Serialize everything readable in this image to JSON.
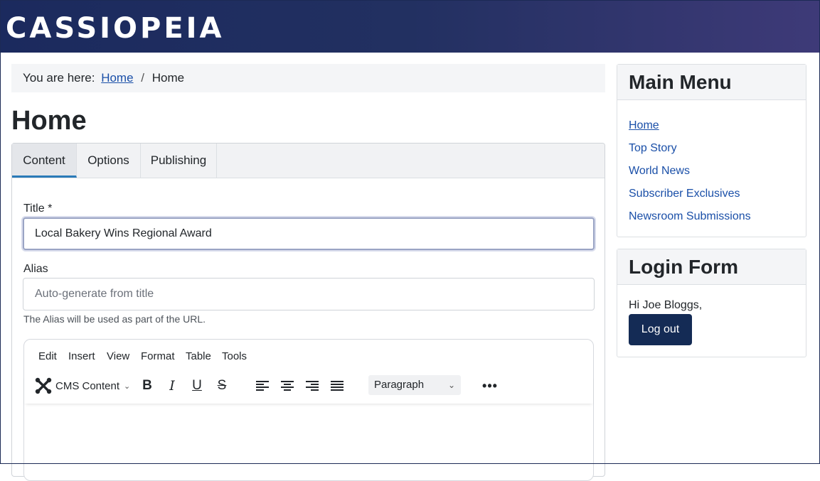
{
  "site": {
    "brand": "CASSIOPEIA"
  },
  "breadcrumb": {
    "prefix": "You are here:",
    "link": "Home",
    "separator": "/",
    "current": "Home"
  },
  "page_title": "Home",
  "tabs": [
    {
      "label": "Content",
      "active": true
    },
    {
      "label": "Options",
      "active": false
    },
    {
      "label": "Publishing",
      "active": false
    }
  ],
  "form": {
    "title_label": "Title *",
    "title_value": "Local Bakery Wins Regional Award",
    "alias_label": "Alias",
    "alias_placeholder": "Auto-generate from title",
    "alias_help": "The Alias will be used as part of the URL."
  },
  "editor": {
    "menus": [
      "Edit",
      "Insert",
      "View",
      "Format",
      "Table",
      "Tools"
    ],
    "cms_content_label": "CMS Content",
    "format_select": "Paragraph",
    "toolbar_icons": [
      "joomla-icon",
      "bold-icon",
      "italic-icon",
      "underline-icon",
      "strikethrough-icon",
      "align-left-icon",
      "align-center-icon",
      "align-right-icon",
      "justify-icon",
      "more-icon"
    ]
  },
  "sidebar": {
    "main_menu": {
      "title": "Main Menu",
      "items": [
        "Home",
        "Top Story",
        "World News",
        "Subscriber Exclusives",
        "Newsroom Submissions"
      ]
    },
    "login": {
      "title": "Login Form",
      "greeting": "Hi Joe Bloggs,",
      "logout_label": "Log out"
    }
  },
  "colors": {
    "header_start": "#1b2a5e",
    "header_end": "#3e3a78",
    "link": "#1a4fa8",
    "button": "#142b55",
    "tab_accent": "#2a7ab8"
  }
}
